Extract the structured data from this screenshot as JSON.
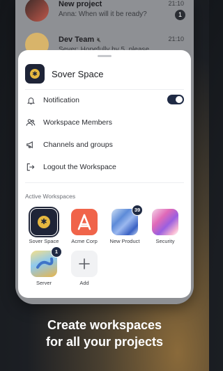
{
  "background_chats": [
    {
      "title": "New project",
      "preview": "Anna: When will it be ready?",
      "time": "21:10",
      "badge": "1"
    },
    {
      "title": "Dev Team",
      "preview": "Sever: Hopefully by 5, please...",
      "time": "21:10"
    }
  ],
  "sheet": {
    "workspace_name": "Sover Space",
    "menu": {
      "notification": "Notification",
      "members": "Workspace Members",
      "channels": "Channels and groups",
      "logout": "Logout the Workspace"
    },
    "notification_enabled": true,
    "active_title": "Active Workspaces",
    "workspaces": [
      {
        "label": "Sover Space",
        "selected": true
      },
      {
        "label": "Acme Corp"
      },
      {
        "label": "New Product",
        "badge": "39"
      },
      {
        "label": "Security"
      },
      {
        "label": "Server",
        "badge": "1"
      },
      {
        "label": "Add"
      }
    ]
  },
  "caption": {
    "line1": "Create workspaces",
    "line2": "for all your projects"
  },
  "colors": {
    "accent": "#1f2a44",
    "logo_gold": "#e6b840",
    "acme": "#f0644a"
  }
}
